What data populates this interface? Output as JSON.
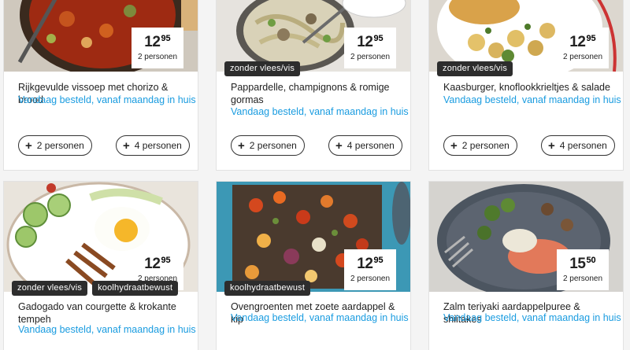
{
  "recipes": [
    {
      "title": "Rijkgevulde vissoep met chorizo & brood",
      "subtitle": "Vandaag besteld, vanaf maandag in huis",
      "price_main": "12",
      "price_cents": "95",
      "persons_label": "2 personen",
      "tags": [],
      "buttons": [
        "2 personen",
        "4 personen"
      ]
    },
    {
      "title": "Pappardelle, champignons & romige gormas",
      "subtitle": "Vandaag besteld, vanaf maandag in huis",
      "price_main": "12",
      "price_cents": "95",
      "persons_label": "2 personen",
      "tags": [
        "zonder vlees/vis"
      ],
      "buttons": [
        "2 personen",
        "4 personen"
      ]
    },
    {
      "title": "Kaasburger, knoflookkrieltjes & salade",
      "subtitle": "Vandaag besteld, vanaf maandag in huis",
      "price_main": "12",
      "price_cents": "95",
      "persons_label": "2 personen",
      "tags": [
        "zonder vlees/vis"
      ],
      "buttons": [
        "2 personen",
        "4 personen"
      ]
    },
    {
      "title": "Gadogado van courgette & krokante tempeh",
      "subtitle": "Vandaag besteld, vanaf maandag in huis",
      "price_main": "12",
      "price_cents": "95",
      "persons_label": "2 personen",
      "tags": [
        "zonder vlees/vis",
        "koolhydraatbewust"
      ]
    },
    {
      "title": "Ovengroenten met zoete aardappel & kip",
      "subtitle": "Vandaag besteld, vanaf maandag in huis",
      "price_main": "12",
      "price_cents": "95",
      "persons_label": "2 personen",
      "tags": [
        "koolhydraatbewust"
      ]
    },
    {
      "title": "Zalm teriyaki aardappelpuree & shiitakes",
      "subtitle": "Vandaag besteld, vanaf maandag in huis",
      "price_main": "15",
      "price_cents": "50",
      "persons_label": "2 personen",
      "tags": []
    }
  ],
  "colors": {
    "link": "#1a9ce0",
    "tag_bg": "#2d2d2d",
    "text": "#222222"
  },
  "icons": {
    "add": "plus-icon"
  }
}
